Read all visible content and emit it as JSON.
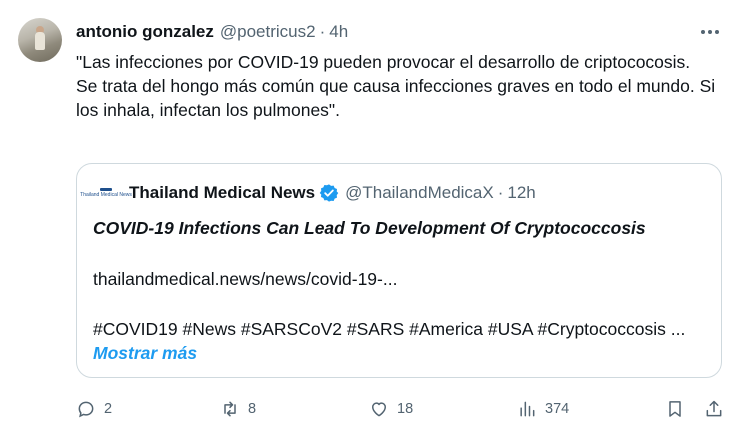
{
  "tweet": {
    "author_name": "antonio gonzalez",
    "author_handle": "@poetricus2",
    "separator": "·",
    "time": "4h",
    "text_lines": [
      "\"Las infecciones por COVID-19 pueden provocar el desarrollo de criptococosis.",
      "Se trata del hongo más común que causa infecciones graves en todo el mundo. Si los inhala, infectan los pulmones\"."
    ]
  },
  "quote": {
    "logo_text": "Thailand Medical News",
    "author_name": "Thailand Medical News",
    "author_handle": "@ThailandMedicaX",
    "separator": "·",
    "time": "12h",
    "title": "COVID-19 Infections Can Lead To Development Of Cryptococcosis",
    "link": "thailandmedical.news/news/covid-19-...",
    "tags": "#COVID19 #News #SARSCoV2 #SARS #America #USA #Cryptococcosis ...",
    "show_more": "Mostrar más"
  },
  "actions": {
    "replies": "2",
    "retweets": "8",
    "likes": "18",
    "views": "374"
  },
  "icons": {
    "more": "more-horizontal-icon",
    "verified": "verified-badge-icon",
    "reply": "reply-icon",
    "retweet": "retweet-icon",
    "like": "heart-icon",
    "views": "views-icon",
    "bookmark": "bookmark-icon",
    "share": "share-icon"
  },
  "colors": {
    "verified": "#1d9bf0",
    "link": "#1d9bf0",
    "secondary_text": "#536471",
    "border": "#cfd9de"
  }
}
